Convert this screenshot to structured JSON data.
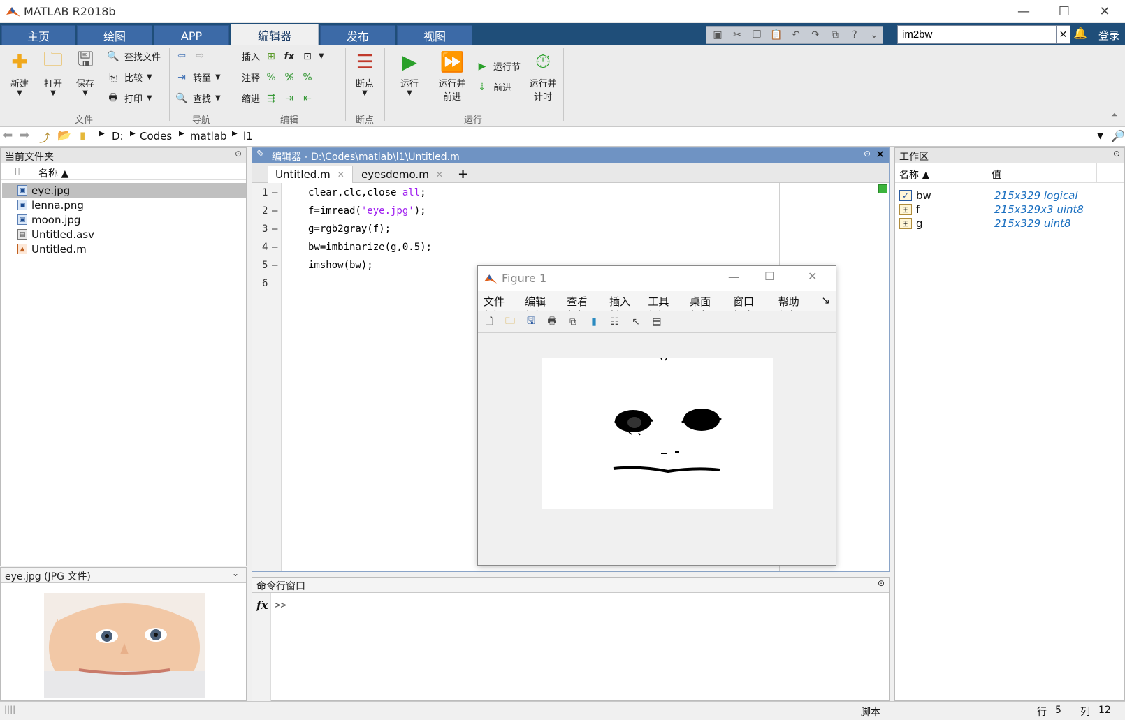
{
  "app": {
    "title": "MATLAB R2018b"
  },
  "window": {
    "minimize": "—",
    "maximize": "☐",
    "close": "✕"
  },
  "tabs": [
    {
      "label": "主页",
      "active": false
    },
    {
      "label": "绘图",
      "active": false
    },
    {
      "label": "APP",
      "active": false
    },
    {
      "label": "编辑器",
      "active": true
    },
    {
      "label": "发布",
      "active": false
    },
    {
      "label": "视图",
      "active": false
    }
  ],
  "search": {
    "value": "im2bw",
    "clear": "✕"
  },
  "login": "登录",
  "ribbon": {
    "file": {
      "group": "文件",
      "new": "新建",
      "open": "打开",
      "save": "保存",
      "find_files": "查找文件",
      "compare": "比较",
      "print": "打印"
    },
    "navigate": {
      "group": "导航",
      "goto": "转至",
      "find": "查找"
    },
    "edit": {
      "group": "编辑",
      "insert": "插入",
      "comment": "注释",
      "indent": "缩进",
      "fx": "fx"
    },
    "breakpoints": {
      "group": "断点",
      "label": "断点"
    },
    "run": {
      "group": "运行",
      "run": "运行",
      "run_advance_1": "运行并",
      "run_advance_2": "前进",
      "run_section": "运行节",
      "advance": "前进",
      "run_time_1": "运行并",
      "run_time_2": "计时"
    }
  },
  "address": {
    "path": [
      "D:",
      "Codes",
      "matlab",
      "l1"
    ]
  },
  "file_browser": {
    "title": "当前文件夹",
    "column_name": "名称 ▲",
    "files": [
      "eye.jpg",
      "lenna.png",
      "moon.jpg",
      "Untitled.asv",
      "Untitled.m"
    ],
    "selected": "eye.jpg"
  },
  "details": {
    "title": "eye.jpg  (JPG 文件)"
  },
  "editor": {
    "title": "编辑器 - D:\\Codes\\matlab\\l1\\Untitled.m",
    "tabs": [
      "Untitled.m",
      "eyesdemo.m"
    ],
    "add_tab": "+",
    "lines": [
      {
        "n": "1",
        "dash": "—",
        "code": "clear,clc,close ",
        "kw": "all",
        "tail": ";"
      },
      {
        "n": "2",
        "dash": "—",
        "code": "f=imread(",
        "kw": "'eye.jpg'",
        "tail": ");"
      },
      {
        "n": "3",
        "dash": "—",
        "code": "g=rgb2gray(f);",
        "kw": "",
        "tail": ""
      },
      {
        "n": "4",
        "dash": "—",
        "code": "bw=imbinarize(g,0.5);",
        "kw": "",
        "tail": ""
      },
      {
        "n": "5",
        "dash": "—",
        "code": "imshow(bw);",
        "kw": "",
        "tail": ""
      },
      {
        "n": "6",
        "dash": "",
        "code": "",
        "kw": "",
        "tail": ""
      }
    ]
  },
  "command_window": {
    "title": "命令行窗口",
    "fx": "fx",
    "prompt": ">>"
  },
  "workspace": {
    "title": "工作区",
    "col_name": "名称 ▲",
    "col_value": "值",
    "vars": [
      {
        "name": "bw",
        "value": "215x329 logical",
        "icon": "check-icon"
      },
      {
        "name": "f",
        "value": "215x329x3 uint8",
        "icon": "grid-icon"
      },
      {
        "name": "g",
        "value": "215x329 uint8",
        "icon": "grid-icon"
      }
    ]
  },
  "figure": {
    "title": "Figure 1",
    "menu": [
      "文件(F)",
      "编辑(E)",
      "查看(V)",
      "插入(I)",
      "工具(T)",
      "桌面(D)",
      "窗口(W)",
      "帮助(H)"
    ],
    "more": "↘"
  },
  "status": {
    "type": "脚本",
    "line_label": "行",
    "line": "5",
    "col_label": "列",
    "col": "12"
  }
}
